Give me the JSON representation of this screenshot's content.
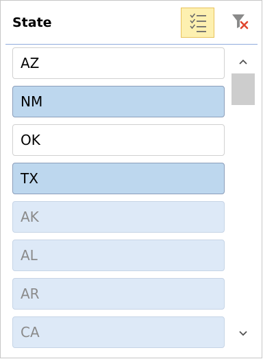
{
  "header": {
    "title": "State",
    "multi_select_icon": "multi-select-checklist-icon",
    "clear_filter_icon": "clear-filter-icon"
  },
  "items": [
    {
      "label": "AZ",
      "state": "normal"
    },
    {
      "label": "NM",
      "state": "selected"
    },
    {
      "label": "OK",
      "state": "normal"
    },
    {
      "label": "TX",
      "state": "selected"
    },
    {
      "label": "AK",
      "state": "nodata"
    },
    {
      "label": "AL",
      "state": "nodata"
    },
    {
      "label": "AR",
      "state": "nodata"
    },
    {
      "label": "CA",
      "state": "nodata"
    }
  ],
  "scrollbar": {
    "up_icon": "chevron-up-icon",
    "down_icon": "chevron-down-icon"
  },
  "colors": {
    "selected_fill": "#bdd7ee",
    "nodata_fill": "#dde9f7",
    "header_line": "#8faadc",
    "active_button_fill": "#fdf0b0",
    "clear_filter_x": "#e0462f"
  }
}
